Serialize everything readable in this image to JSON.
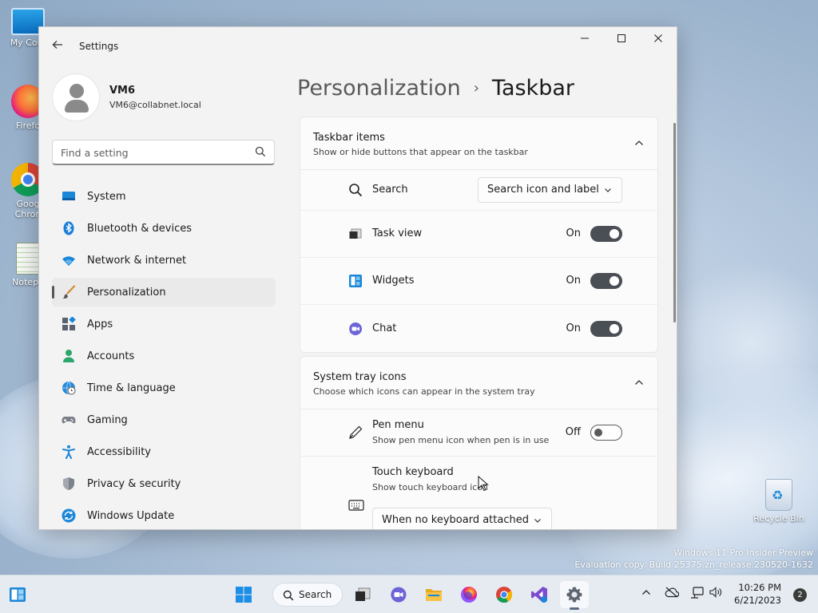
{
  "desktop": {
    "icons": [
      {
        "label": "My Com",
        "icon": "monitor-icon"
      },
      {
        "label": "Firefo",
        "icon": "firefox-icon"
      },
      {
        "label": "Goog",
        "label2": "Chron",
        "icon": "chrome-icon"
      },
      {
        "label": "Notepa",
        "icon": "notepad-icon"
      },
      {
        "label": "Recycle Bin",
        "icon": "recycle-bin-icon"
      }
    ],
    "watermark": {
      "line1": "Windows 11 Pro Insider Preview",
      "line2": "Evaluation copy. Build 25375.zn_release.230520-1632"
    }
  },
  "window": {
    "title": "Settings",
    "controls": {
      "minimize": "—",
      "maximize": "☐",
      "close": "✕"
    }
  },
  "profile": {
    "name": "VM6",
    "email": "VM6@collabnet.local"
  },
  "search": {
    "placeholder": "Find a setting"
  },
  "sidebar": {
    "items": [
      {
        "label": "System",
        "icon": "system-icon"
      },
      {
        "label": "Bluetooth & devices",
        "icon": "bluetooth-icon"
      },
      {
        "label": "Network & internet",
        "icon": "wifi-icon"
      },
      {
        "label": "Personalization",
        "icon": "brush-icon",
        "active": true
      },
      {
        "label": "Apps",
        "icon": "apps-icon"
      },
      {
        "label": "Accounts",
        "icon": "accounts-icon"
      },
      {
        "label": "Time & language",
        "icon": "globe-clock-icon"
      },
      {
        "label": "Gaming",
        "icon": "gamepad-icon"
      },
      {
        "label": "Accessibility",
        "icon": "accessibility-icon"
      },
      {
        "label": "Privacy & security",
        "icon": "shield-icon"
      },
      {
        "label": "Windows Update",
        "icon": "update-icon"
      }
    ]
  },
  "breadcrumb": {
    "parent": "Personalization",
    "separator": "›",
    "current": "Taskbar"
  },
  "taskbar_items": {
    "title": "Taskbar items",
    "subtitle": "Show or hide buttons that appear on the taskbar",
    "search": {
      "label": "Search",
      "value": "Search icon and label"
    },
    "task_view": {
      "label": "Task view",
      "state": "On"
    },
    "widgets": {
      "label": "Widgets",
      "state": "On"
    },
    "chat": {
      "label": "Chat",
      "state": "On"
    }
  },
  "system_tray": {
    "title": "System tray icons",
    "subtitle": "Choose which icons can appear in the system tray",
    "pen_menu": {
      "label": "Pen menu",
      "description": "Show pen menu icon when pen is in use",
      "state": "Off"
    },
    "touch_keyboard": {
      "label": "Touch keyboard",
      "description": "Show touch keyboard icon",
      "value": "When no keyboard attached"
    }
  },
  "taskbar": {
    "search_label": "Search",
    "clock_time": "10:26 PM",
    "clock_date": "6/21/2023",
    "notification_count": "2"
  },
  "colors": {
    "accent": "#0067c0",
    "toggle_on": "#4a4f55"
  }
}
